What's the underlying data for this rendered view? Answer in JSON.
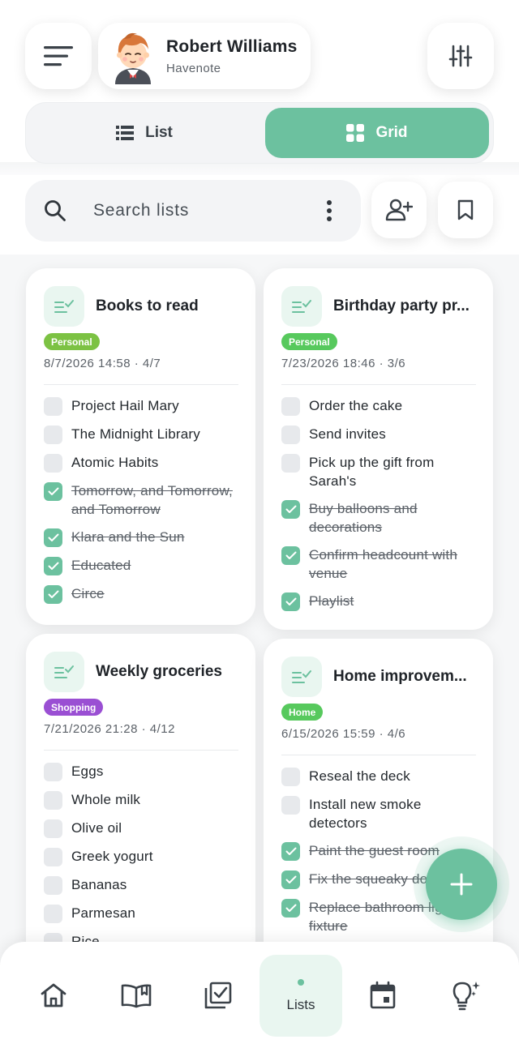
{
  "profile": {
    "name": "Robert Williams",
    "subtitle": "Havenote"
  },
  "view_toggle": {
    "list_label": "List",
    "grid_label": "Grid",
    "selected": "Grid"
  },
  "search": {
    "placeholder": "Search lists"
  },
  "colors": {
    "accent": "#6cc19f",
    "personal": "#7cc243",
    "shopping": "#9a4fd3",
    "home": "#57c95d"
  },
  "cards": [
    {
      "title": "Books to read",
      "tag": "Personal",
      "meta": "8/7/2026 14:58 · 4/7",
      "items": [
        {
          "text": "Project Hail Mary",
          "done": false
        },
        {
          "text": "The Midnight Library",
          "done": false
        },
        {
          "text": "Atomic Habits",
          "done": false
        },
        {
          "text": "Tomorrow, and Tomorrow, and Tomorrow",
          "done": true
        },
        {
          "text": "Klara and the Sun",
          "done": true
        },
        {
          "text": "Educated",
          "done": true
        },
        {
          "text": "Circe",
          "done": true
        }
      ]
    },
    {
      "title": "Birthday party pr...",
      "tag": "Personal",
      "meta": "7/23/2026 18:46 · 3/6",
      "items": [
        {
          "text": "Order the cake",
          "done": false
        },
        {
          "text": "Send invites",
          "done": false
        },
        {
          "text": "Pick up the gift from Sarah's",
          "done": false
        },
        {
          "text": "Buy balloons and decorations",
          "done": true
        },
        {
          "text": "Confirm headcount with venue",
          "done": true
        },
        {
          "text": "Playlist",
          "done": true
        }
      ]
    },
    {
      "title": "Weekly groceries",
      "tag": "Shopping",
      "meta": "7/21/2026 21:28 · 4/12",
      "items": [
        {
          "text": "Eggs",
          "done": false
        },
        {
          "text": "Whole milk",
          "done": false
        },
        {
          "text": "Olive oil",
          "done": false
        },
        {
          "text": "Greek yogurt",
          "done": false
        },
        {
          "text": "Bananas",
          "done": false
        },
        {
          "text": "Parmesan",
          "done": false
        },
        {
          "text": "Rice",
          "done": false
        }
      ]
    },
    {
      "title": "Home improvem...",
      "tag": "Home",
      "meta": "6/15/2026 15:59 · 4/6",
      "items": [
        {
          "text": "Reseal the deck",
          "done": false
        },
        {
          "text": "Install new smoke detectors",
          "done": false
        },
        {
          "text": "Paint the guest room",
          "done": true
        },
        {
          "text": "Fix the squeaky door hinge",
          "done": true
        },
        {
          "text": "Replace bathroom light fixture",
          "done": true
        }
      ]
    }
  ],
  "bottom_nav": {
    "items": [
      "home-icon",
      "book-icon",
      "checklist-icon",
      "Lists",
      "calendar-icon",
      "lightbulb-icon"
    ],
    "active_label": "Lists"
  }
}
